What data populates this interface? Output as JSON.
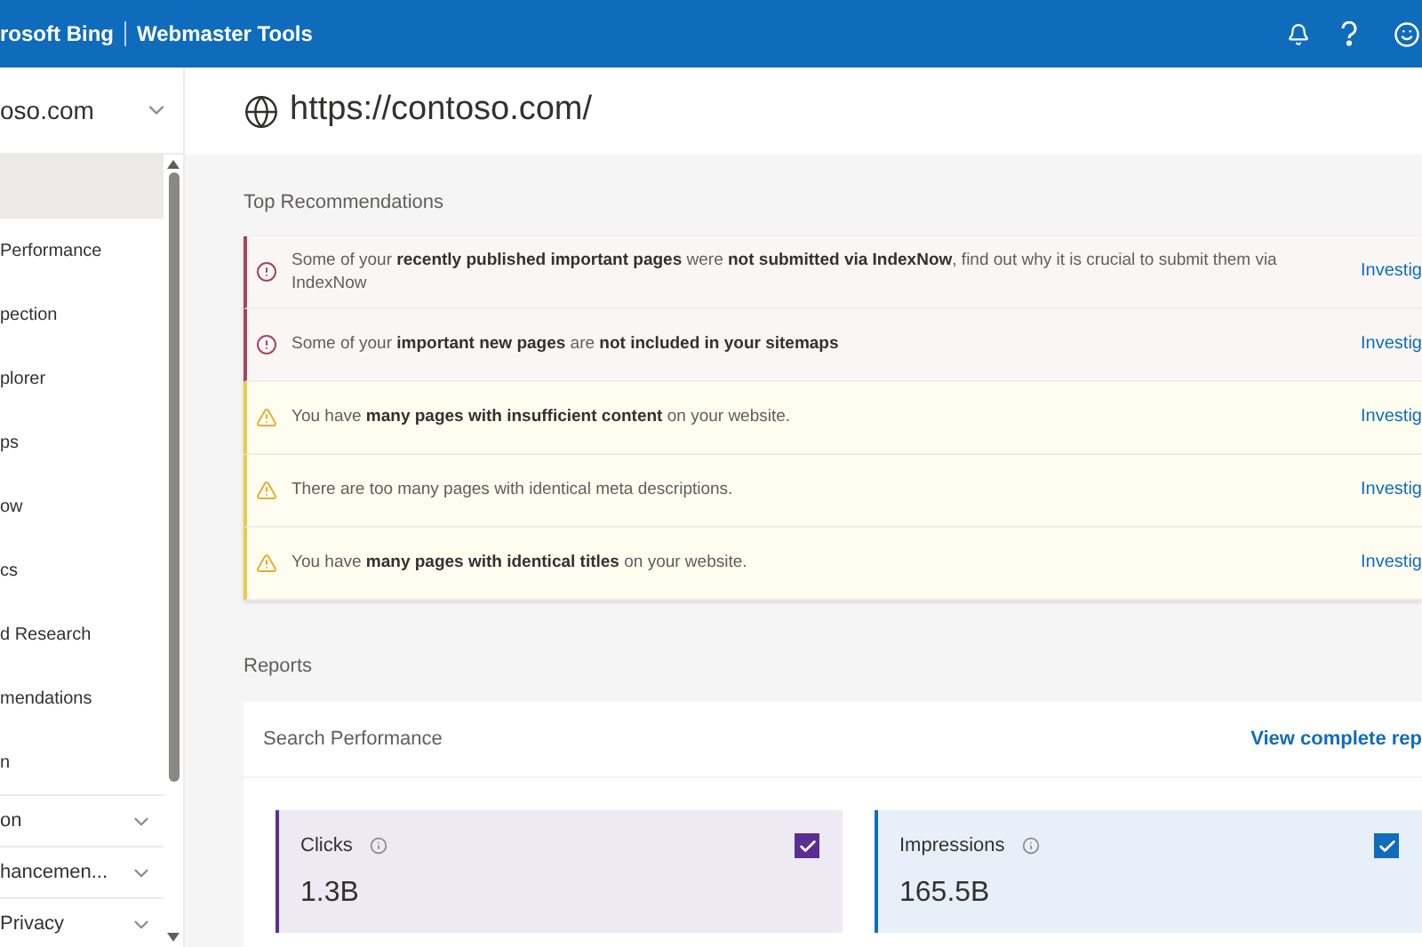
{
  "header": {
    "brand": "rosoft Bing",
    "product": "Webmaster Tools"
  },
  "sidebar": {
    "site": "oso.com",
    "items": [
      {
        "selected": true
      },
      {
        "label": "Performance",
        "selected": false
      },
      {
        "label": "pection",
        "selected": false
      },
      {
        "label": "plorer",
        "selected": false
      },
      {
        "label": "ps",
        "selected": false
      },
      {
        "label": "ow",
        "selected": false
      },
      {
        "label": "cs",
        "selected": false
      },
      {
        "label": "d Research",
        "selected": false
      },
      {
        "label": "mendations",
        "selected": false
      },
      {
        "label": "n",
        "selected": false
      }
    ],
    "groups": [
      {
        "label": "on",
        "expanded": false
      },
      {
        "label": "hancemen...",
        "expanded": false
      },
      {
        "label": "Privacy",
        "expanded": false
      }
    ]
  },
  "site_url": "https://contoso.com/",
  "recommendations": {
    "title": "Top Recommendations",
    "items": [
      {
        "kind": "error",
        "text": "Some of your **recently published important pages** were **not submitted via IndexNow**, find out why it is crucial to submit them via IndexNow",
        "action": "Investig"
      },
      {
        "kind": "error",
        "text": "Some of your **important new pages** are **not included in your sitemaps**",
        "action": "Investig"
      },
      {
        "kind": "warning",
        "text": "You have **many pages with insufficient content** on your website.",
        "action": "Investig"
      },
      {
        "kind": "warning",
        "text": "There are too many pages with identical meta descriptions.",
        "action": "Investig"
      },
      {
        "kind": "warning",
        "text": "You have **many pages with identical titles** on your website.",
        "action": "Investig"
      }
    ]
  },
  "reports": {
    "title": "Reports",
    "card": {
      "title": "Search Performance",
      "link": "View complete rep",
      "metrics": [
        {
          "label": "Clicks",
          "value": "1.3B",
          "checked": true,
          "color": "#5c2e91"
        },
        {
          "label": "Impressions",
          "value": "165.5B",
          "checked": true,
          "color": "#0f6cbd"
        }
      ]
    }
  }
}
